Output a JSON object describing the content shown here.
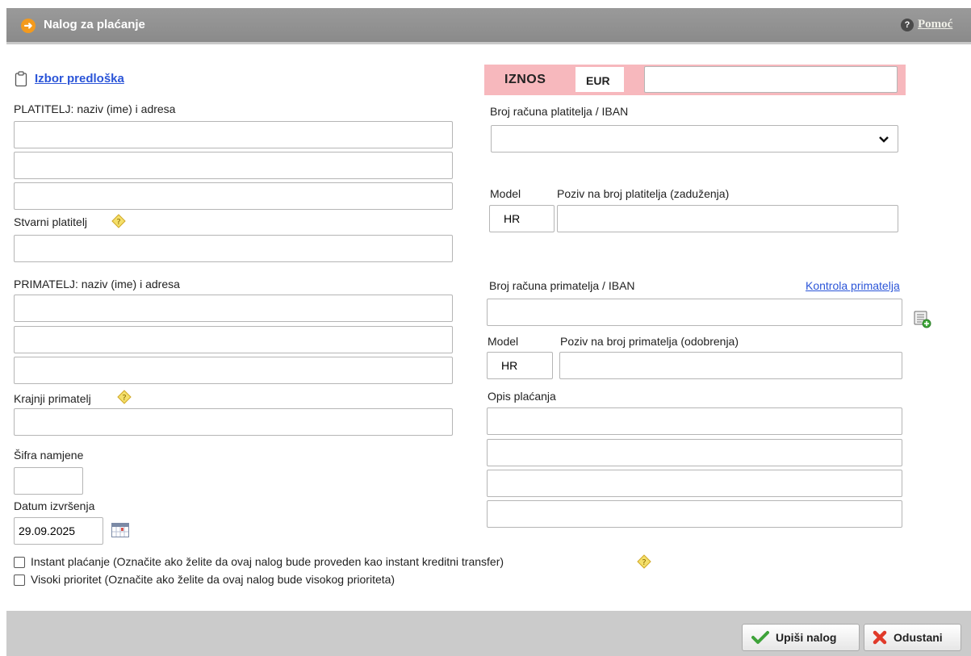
{
  "header": {
    "title": "Nalog za plaćanje",
    "help_label": "Pomoć"
  },
  "template": {
    "link_label": "Izbor predloška"
  },
  "payer": {
    "label": "PLATITELJ: naziv (ime) i adresa",
    "lines": [
      "",
      "",
      ""
    ],
    "actual_payer_label": "Stvarni platitelj",
    "actual_payer_value": ""
  },
  "recipient": {
    "label": "PRIMATELJ: naziv (ime) i adresa",
    "lines": [
      "",
      "",
      ""
    ],
    "final_recipient_label": "Krajnji primatelj",
    "final_recipient_value": ""
  },
  "purpose_code": {
    "label": "Šifra namjene",
    "value": ""
  },
  "execution_date": {
    "label": "Datum izvršenja",
    "value": "29.09.2025"
  },
  "amount": {
    "label": "IZNOS",
    "currency": "EUR",
    "value": ""
  },
  "payer_account": {
    "label": "Broj računa platitelja / IBAN",
    "selected": ""
  },
  "payer_reference": {
    "model_label": "Model",
    "model_value": "HR",
    "reference_label": "Poziv na broj platitelja (zaduženja)",
    "reference_value": ""
  },
  "recipient_account": {
    "label": "Broj računa primatelja / IBAN",
    "check_link": "Kontrola primatelja",
    "value": ""
  },
  "recipient_reference": {
    "model_label": "Model",
    "model_value": "HR",
    "reference_label": "Poziv na broj primatelja (odobrenja)",
    "reference_value": ""
  },
  "description": {
    "label": "Opis plaćanja",
    "lines": [
      "",
      "",
      "",
      ""
    ]
  },
  "options": {
    "instant_label": "Instant plaćanje (Označite ako želite da ovaj nalog bude proveden kao instant kreditni transfer)",
    "instant_checked": false,
    "priority_label": "Visoki prioritet (Označite ako želite da ovaj nalog bude visokog prioriteta)",
    "priority_checked": false
  },
  "footer": {
    "submit_label": "Upiši nalog",
    "cancel_label": "Odustani"
  },
  "colors": {
    "header_bg": "#8e8e8e",
    "amount_bar": "#f7b8bd",
    "link": "#2b55d8",
    "footer_bg": "#cbcbcb"
  }
}
